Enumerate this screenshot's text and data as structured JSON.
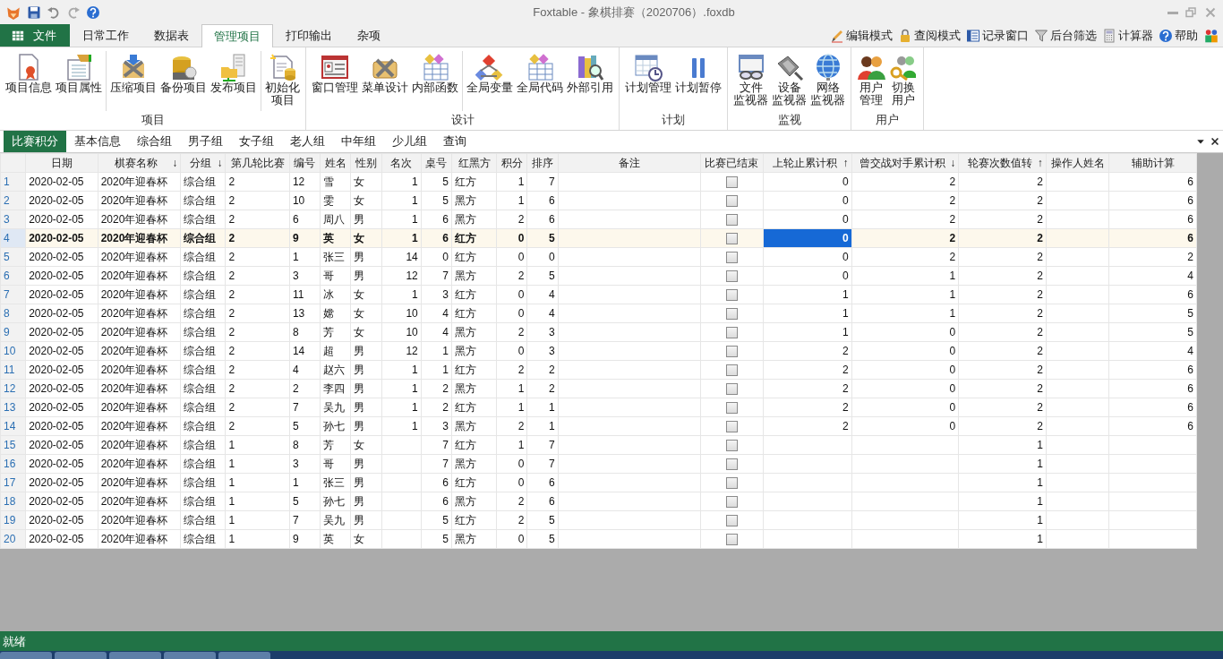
{
  "window": {
    "title": "Foxtable - 象棋排赛（2020706）.foxdb"
  },
  "ribbon_tabs": [
    {
      "label": "文件",
      "kind": "file",
      "selected": false
    },
    {
      "label": "日常工作",
      "kind": "tab",
      "selected": false
    },
    {
      "label": "数据表",
      "kind": "tab",
      "selected": false
    },
    {
      "label": "管理项目",
      "kind": "tab",
      "selected": true
    },
    {
      "label": "打印输出",
      "kind": "tab",
      "selected": false
    },
    {
      "label": "杂项",
      "kind": "tab",
      "selected": false
    }
  ],
  "quick_tools": [
    {
      "label": "编辑模式"
    },
    {
      "label": "查阅模式"
    },
    {
      "label": "记录窗口"
    },
    {
      "label": "后台筛选"
    },
    {
      "label": "计算器"
    },
    {
      "label": "帮助"
    }
  ],
  "ribbon_groups": [
    {
      "label": "项目",
      "sections": [
        [
          {
            "label": "项目信息"
          },
          {
            "label": "项目属性"
          }
        ],
        [
          {
            "label": "压缩项目"
          },
          {
            "label": "备份项目"
          },
          {
            "label": "发布项目"
          }
        ],
        [
          {
            "lines": [
              "初始化",
              "项目"
            ]
          }
        ]
      ]
    },
    {
      "label": "设计",
      "sections": [
        [
          {
            "label": "窗口管理"
          },
          {
            "label": "菜单设计"
          },
          {
            "label": "内部函数"
          }
        ],
        [
          {
            "label": "全局变量"
          },
          {
            "label": "全局代码"
          },
          {
            "label": "外部引用"
          }
        ]
      ]
    },
    {
      "label": "计划",
      "sections": [
        [
          {
            "label": "计划管理"
          },
          {
            "label": "计划暂停"
          }
        ]
      ]
    },
    {
      "label": "监视",
      "sections": [
        [
          {
            "lines": [
              "文件",
              "监视器"
            ]
          },
          {
            "lines": [
              "设备",
              "监视器"
            ]
          },
          {
            "lines": [
              "网络",
              "监视器"
            ]
          }
        ]
      ]
    },
    {
      "label": "用户",
      "sections": [
        [
          {
            "lines": [
              "用户",
              "管理"
            ]
          },
          {
            "lines": [
              "切换",
              "用户"
            ]
          }
        ]
      ]
    }
  ],
  "table_tabs": [
    {
      "label": "比赛积分",
      "selected": true
    },
    {
      "label": "基本信息",
      "selected": false
    },
    {
      "label": "综合组",
      "selected": false
    },
    {
      "label": "男子组",
      "selected": false
    },
    {
      "label": "女子组",
      "selected": false
    },
    {
      "label": "老人组",
      "selected": false
    },
    {
      "label": "中年组",
      "selected": false
    },
    {
      "label": "少儿组",
      "selected": false
    },
    {
      "label": "查询",
      "selected": false
    }
  ],
  "table": {
    "columns": [
      {
        "label": "日期",
        "kind": "text",
        "focused": false
      },
      {
        "label": "棋赛名称",
        "kind": "text",
        "sort_arrow": "↓",
        "focused": false
      },
      {
        "label": "分组",
        "kind": "text",
        "sort_arrow": "↓",
        "focused": false
      },
      {
        "label": "第几轮比赛",
        "kind": "text",
        "focused": false
      },
      {
        "label": "编号",
        "kind": "text",
        "focused": false
      },
      {
        "label": "姓名",
        "kind": "text",
        "focused": false
      },
      {
        "label": "性别",
        "kind": "text",
        "focused": false
      },
      {
        "label": "名次",
        "kind": "number",
        "focused": false
      },
      {
        "label": "桌号",
        "kind": "number",
        "focused": false
      },
      {
        "label": "红黑方",
        "kind": "text",
        "focused": false
      },
      {
        "label": "积分",
        "kind": "number",
        "focused": false
      },
      {
        "label": "排序",
        "kind": "number",
        "focused": false
      },
      {
        "label": "备注",
        "kind": "text",
        "focused": false
      },
      {
        "label": "比赛已结束",
        "kind": "checkbox",
        "focused": false
      },
      {
        "label": "上轮止累计积",
        "kind": "number",
        "sort_arrow": "↑",
        "focused": true
      },
      {
        "label": "曾交战对手累计积",
        "kind": "number",
        "sort_arrow": "↓",
        "focused": false
      },
      {
        "label": "轮赛次数值转",
        "kind": "number",
        "sort_arrow": "↑",
        "focused": false
      },
      {
        "label": "操作人姓名",
        "kind": "text",
        "focused": false
      },
      {
        "label": "辅助计算",
        "kind": "number",
        "focused": false
      }
    ],
    "rows": [
      {
        "number": "1",
        "selected": false,
        "finished": false,
        "cells": [
          "2020-02-05",
          "2020年迎春杯",
          "综合组",
          "2",
          "12",
          "雪",
          "女",
          "1",
          "5",
          "红方",
          "1",
          "7",
          null,
          null,
          "0",
          "2",
          "2",
          null,
          "6"
        ]
      },
      {
        "number": "2",
        "selected": false,
        "finished": false,
        "cells": [
          "2020-02-05",
          "2020年迎春杯",
          "综合组",
          "2",
          "10",
          "雯",
          "女",
          "1",
          "5",
          "黑方",
          "1",
          "6",
          null,
          null,
          "0",
          "2",
          "2",
          null,
          "6"
        ]
      },
      {
        "number": "3",
        "selected": false,
        "finished": false,
        "cells": [
          "2020-02-05",
          "2020年迎春杯",
          "综合组",
          "2",
          "6",
          "周八",
          "男",
          "1",
          "6",
          "黑方",
          "2",
          "6",
          null,
          null,
          "0",
          "2",
          "2",
          null,
          "6"
        ]
      },
      {
        "number": "4",
        "selected": true,
        "finished": false,
        "cells": [
          "2020-02-05",
          "2020年迎春杯",
          "综合组",
          "2",
          "9",
          "英",
          "女",
          "1",
          "6",
          "红方",
          "0",
          "5",
          null,
          null,
          "0",
          "2",
          "2",
          null,
          "6"
        ]
      },
      {
        "number": "5",
        "selected": false,
        "finished": false,
        "cells": [
          "2020-02-05",
          "2020年迎春杯",
          "综合组",
          "2",
          "1",
          "张三",
          "男",
          "14",
          "0",
          "红方",
          "0",
          "0",
          null,
          null,
          "0",
          "2",
          "2",
          null,
          "2"
        ]
      },
      {
        "number": "6",
        "selected": false,
        "finished": false,
        "cells": [
          "2020-02-05",
          "2020年迎春杯",
          "综合组",
          "2",
          "3",
          "哥",
          "男",
          "12",
          "7",
          "黑方",
          "2",
          "5",
          null,
          null,
          "0",
          "1",
          "2",
          null,
          "4"
        ]
      },
      {
        "number": "7",
        "selected": false,
        "finished": false,
        "cells": [
          "2020-02-05",
          "2020年迎春杯",
          "综合组",
          "2",
          "11",
          "冰",
          "女",
          "1",
          "3",
          "红方",
          "0",
          "4",
          null,
          null,
          "1",
          "1",
          "2",
          null,
          "6"
        ]
      },
      {
        "number": "8",
        "selected": false,
        "finished": false,
        "cells": [
          "2020-02-05",
          "2020年迎春杯",
          "综合组",
          "2",
          "13",
          "嫦",
          "女",
          "10",
          "4",
          "红方",
          "0",
          "4",
          null,
          null,
          "1",
          "1",
          "2",
          null,
          "5"
        ]
      },
      {
        "number": "9",
        "selected": false,
        "finished": false,
        "cells": [
          "2020-02-05",
          "2020年迎春杯",
          "综合组",
          "2",
          "8",
          "芳",
          "女",
          "10",
          "4",
          "黑方",
          "2",
          "3",
          null,
          null,
          "1",
          "0",
          "2",
          null,
          "5"
        ]
      },
      {
        "number": "10",
        "selected": false,
        "finished": false,
        "cells": [
          "2020-02-05",
          "2020年迎春杯",
          "综合组",
          "2",
          "14",
          "超",
          "男",
          "12",
          "1",
          "黑方",
          "0",
          "3",
          null,
          null,
          "2",
          "0",
          "2",
          null,
          "4"
        ]
      },
      {
        "number": "11",
        "selected": false,
        "finished": false,
        "cells": [
          "2020-02-05",
          "2020年迎春杯",
          "综合组",
          "2",
          "4",
          "赵六",
          "男",
          "1",
          "1",
          "红方",
          "2",
          "2",
          null,
          null,
          "2",
          "0",
          "2",
          null,
          "6"
        ]
      },
      {
        "number": "12",
        "selected": false,
        "finished": false,
        "cells": [
          "2020-02-05",
          "2020年迎春杯",
          "综合组",
          "2",
          "2",
          "李四",
          "男",
          "1",
          "2",
          "黑方",
          "1",
          "2",
          null,
          null,
          "2",
          "0",
          "2",
          null,
          "6"
        ]
      },
      {
        "number": "13",
        "selected": false,
        "finished": false,
        "cells": [
          "2020-02-05",
          "2020年迎春杯",
          "综合组",
          "2",
          "7",
          "吴九",
          "男",
          "1",
          "2",
          "红方",
          "1",
          "1",
          null,
          null,
          "2",
          "0",
          "2",
          null,
          "6"
        ]
      },
      {
        "number": "14",
        "selected": false,
        "finished": false,
        "cells": [
          "2020-02-05",
          "2020年迎春杯",
          "综合组",
          "2",
          "5",
          "孙七",
          "男",
          "1",
          "3",
          "黑方",
          "2",
          "1",
          null,
          null,
          "2",
          "0",
          "2",
          null,
          "6"
        ]
      },
      {
        "number": "15",
        "selected": false,
        "finished": false,
        "cells": [
          "2020-02-05",
          "2020年迎春杯",
          "综合组",
          "1",
          "8",
          "芳",
          "女",
          null,
          "7",
          "红方",
          "1",
          "7",
          null,
          null,
          null,
          null,
          "1",
          null,
          null
        ]
      },
      {
        "number": "16",
        "selected": false,
        "finished": false,
        "cells": [
          "2020-02-05",
          "2020年迎春杯",
          "综合组",
          "1",
          "3",
          "哥",
          "男",
          null,
          "7",
          "黑方",
          "0",
          "7",
          null,
          null,
          null,
          null,
          "1",
          null,
          null
        ]
      },
      {
        "number": "17",
        "selected": false,
        "finished": false,
        "cells": [
          "2020-02-05",
          "2020年迎春杯",
          "综合组",
          "1",
          "1",
          "张三",
          "男",
          null,
          "6",
          "红方",
          "0",
          "6",
          null,
          null,
          null,
          null,
          "1",
          null,
          null
        ]
      },
      {
        "number": "18",
        "selected": false,
        "finished": false,
        "cells": [
          "2020-02-05",
          "2020年迎春杯",
          "综合组",
          "1",
          "5",
          "孙七",
          "男",
          null,
          "6",
          "黑方",
          "2",
          "6",
          null,
          null,
          null,
          null,
          "1",
          null,
          null
        ]
      },
      {
        "number": "19",
        "selected": false,
        "finished": false,
        "cells": [
          "2020-02-05",
          "2020年迎春杯",
          "综合组",
          "1",
          "7",
          "吴九",
          "男",
          null,
          "5",
          "红方",
          "2",
          "5",
          null,
          null,
          null,
          null,
          "1",
          null,
          null
        ]
      },
      {
        "number": "20",
        "selected": false,
        "finished": false,
        "cells": [
          "2020-02-05",
          "2020年迎春杯",
          "综合组",
          "1",
          "9",
          "英",
          "女",
          null,
          "5",
          "黑方",
          "0",
          "5",
          null,
          null,
          null,
          null,
          "1",
          null,
          null
        ]
      }
    ]
  },
  "status_bar": {
    "text": "就绪"
  }
}
